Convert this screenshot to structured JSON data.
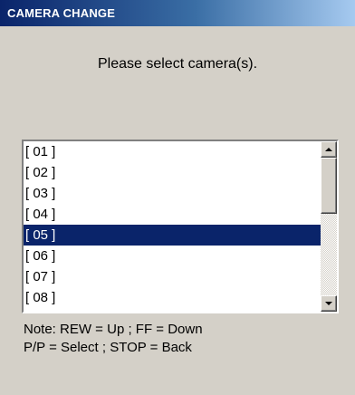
{
  "window": {
    "title": "CAMERA CHANGE"
  },
  "prompt": "Please select camera(s).",
  "camera_list": {
    "items": [
      "[ 01 ]",
      "[ 02 ]",
      "[ 03 ]",
      "[ 04 ]",
      "[ 05 ]",
      "[ 06 ]",
      "[ 07 ]",
      "[ 08 ]"
    ],
    "selected": "[ 05 ]"
  },
  "icons": {
    "scroll_up": "arrow-up-icon",
    "scroll_down": "arrow-down-icon"
  },
  "note": {
    "line1": "Note: REW = Up ; FF = Down",
    "line2": "P/P = Select ; STOP = Back"
  },
  "colors": {
    "title_bar": "#0a246a",
    "selection": "#0a246a",
    "dialog_bg": "#d4d0c8"
  }
}
